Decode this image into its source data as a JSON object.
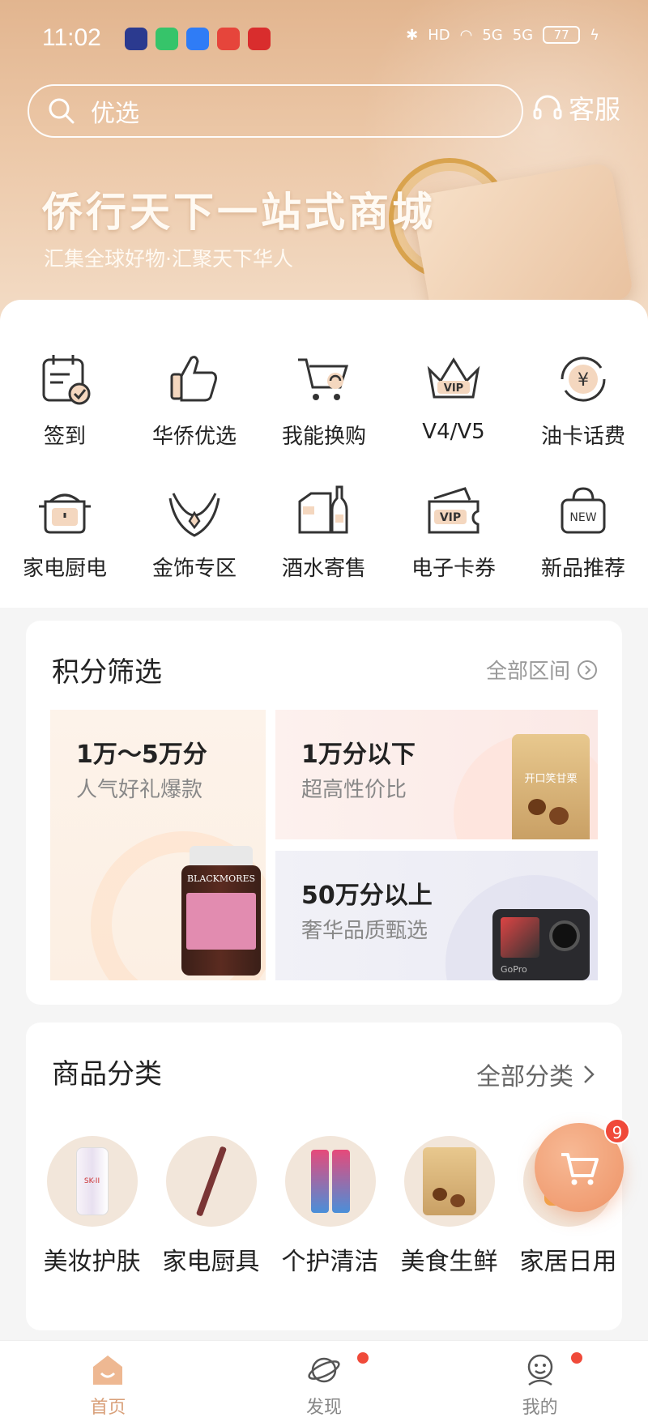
{
  "status_bar": {
    "time": "11:02",
    "network": "HD",
    "signal1": "5G",
    "signal2": "5G",
    "battery": "77"
  },
  "search": {
    "placeholder": "优选",
    "service_label": "客服"
  },
  "banner": {
    "title": "侨行天下一站式商城",
    "subtitle": "汇集全球好物·汇聚天下华人"
  },
  "shortcuts": [
    {
      "label": "签到",
      "icon": "calendar-check-icon"
    },
    {
      "label": "华侨优选",
      "icon": "thumbs-up-icon"
    },
    {
      "label": "我能换购",
      "icon": "cart-exchange-icon"
    },
    {
      "label": "V4/V5",
      "icon": "vip-crown-icon"
    },
    {
      "label": "油卡话费",
      "icon": "yuan-cycle-icon"
    },
    {
      "label": "家电厨电",
      "icon": "rice-cooker-icon"
    },
    {
      "label": "金饰专区",
      "icon": "necklace-icon"
    },
    {
      "label": "酒水寄售",
      "icon": "wine-box-icon"
    },
    {
      "label": "电子卡券",
      "icon": "vip-ticket-icon"
    },
    {
      "label": "新品推荐",
      "icon": "new-bag-icon"
    }
  ],
  "shortcut_extra": {
    "vip_text": "VIP",
    "new_text": "NEW",
    "yuan": "¥"
  },
  "points": {
    "title": "积分筛选",
    "more": "全部区间",
    "tiles": [
      {
        "title": "1万～5万分",
        "desc": "人气好礼爆款",
        "product": "BLACKMORES"
      },
      {
        "title": "1万分以下",
        "desc": "超高性价比",
        "product": "开口笑甘栗"
      },
      {
        "title": "50万分以上",
        "desc": "奢华品质甄选",
        "product": "GoPro"
      }
    ]
  },
  "categories": {
    "title": "商品分类",
    "more": "全部分类",
    "items": [
      {
        "label": "美妆护肤",
        "product": "SK-II"
      },
      {
        "label": "家电厨具"
      },
      {
        "label": "个护清洁"
      },
      {
        "label": "美食生鲜"
      },
      {
        "label": "家居日用"
      }
    ]
  },
  "cart": {
    "badge": "9"
  },
  "nav": [
    {
      "label": "首页",
      "active": true
    },
    {
      "label": "发现"
    },
    {
      "label": "我的"
    }
  ],
  "colors": {
    "accent": "#d9a07a",
    "badge": "#f04a3a",
    "header_start": "#e2b58f",
    "header_end": "#f3dcc6"
  }
}
